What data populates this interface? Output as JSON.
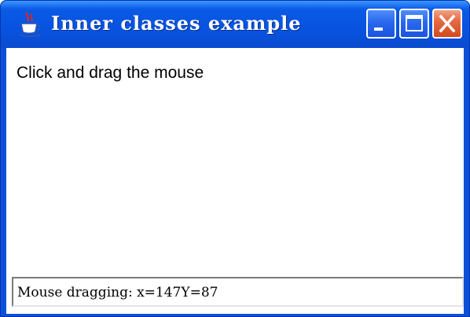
{
  "window": {
    "title": "Inner classes example",
    "icon": "java-coffee-cup-icon",
    "controls": {
      "minimize_icon": "minimize-icon",
      "maximize_icon": "maximize-icon",
      "close_icon": "close-icon"
    },
    "colors": {
      "titlebar": "#0753e0",
      "close_button": "#d24a1e",
      "client_background": "#ffffff"
    }
  },
  "content": {
    "instruction_label": "Click and drag the mouse"
  },
  "status_field": {
    "value": "Mouse dragging: x=147Y=87"
  }
}
